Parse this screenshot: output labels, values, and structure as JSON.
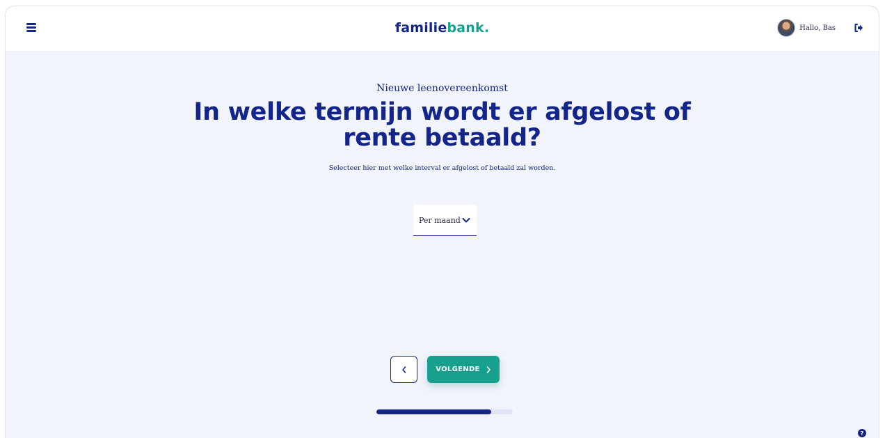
{
  "header": {
    "logo": {
      "part1": "familie",
      "part2": "bank",
      "part3": "."
    },
    "greeting": "Hallo, Bas",
    "menu_icon": "hamburger-menu-icon",
    "logout_icon": "logout-icon"
  },
  "main": {
    "eyebrow": "Nieuwe leenovereenkomst",
    "title": "In welke termijn wordt er afgelost of rente betaald?",
    "subtitle": "Selecteer hier met welke interval er afgelost of betaald zal worden.",
    "interval_select": {
      "selected": "Per maand"
    }
  },
  "footer_nav": {
    "back_icon": "chevron-left-icon",
    "next_label": "VOLGENDE",
    "next_icon": "chevron-right-icon",
    "progress": 0.84
  },
  "help_icon": "question-icon",
  "colors": {
    "primary": "#13248a",
    "accent": "#18a08f",
    "background": "#f2f4fb"
  }
}
